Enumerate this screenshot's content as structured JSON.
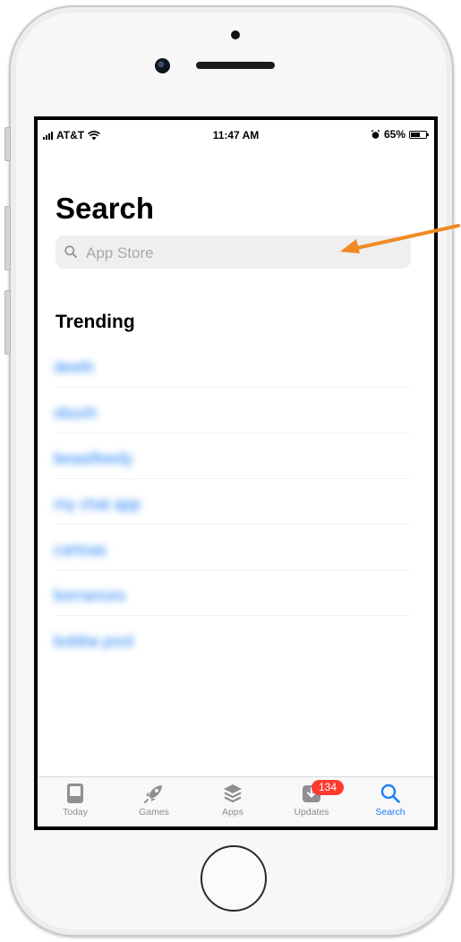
{
  "status_bar": {
    "carrier": "AT&T",
    "time": "11:47 AM",
    "battery_percent": "65%",
    "battery_level": 0.65
  },
  "page": {
    "title": "Search",
    "search_placeholder": "App Store"
  },
  "trending": {
    "title": "Trending",
    "items": [
      {
        "label": "deeth"
      },
      {
        "label": "sbuxh"
      },
      {
        "label": "beastfeedy"
      },
      {
        "label": "my chal app"
      },
      {
        "label": "cartoas"
      },
      {
        "label": "borrances"
      },
      {
        "label": "bobba pool"
      }
    ]
  },
  "tab_bar": {
    "tabs": [
      {
        "label": "Today",
        "icon": "today-icon"
      },
      {
        "label": "Games",
        "icon": "rocket-icon"
      },
      {
        "label": "Apps",
        "icon": "layers-icon"
      },
      {
        "label": "Updates",
        "icon": "download-icon",
        "badge": "134"
      },
      {
        "label": "Search",
        "icon": "search-icon",
        "active": true
      }
    ]
  },
  "colors": {
    "accent": "#1d7ef6",
    "badge": "#ff3b30",
    "annotation_arrow": "#f08a24"
  }
}
